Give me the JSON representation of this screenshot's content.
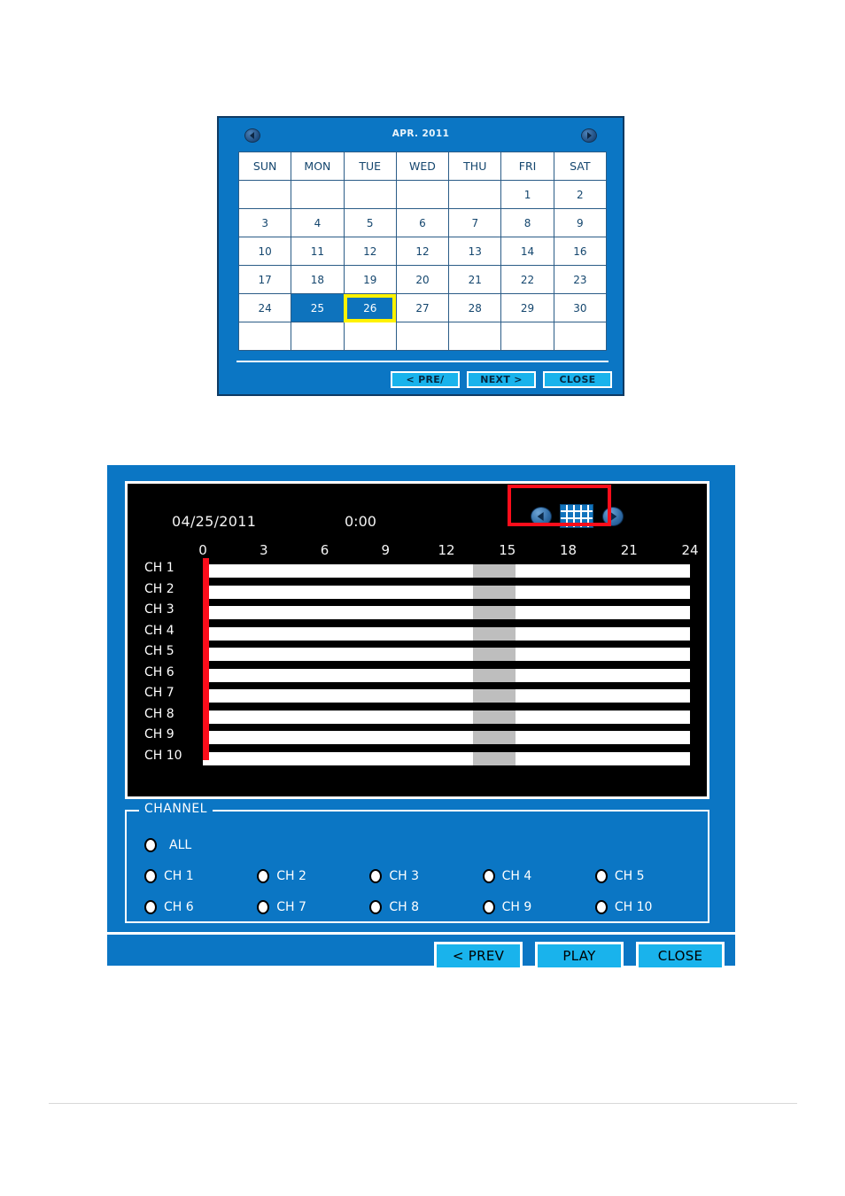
{
  "calendar_dialog": {
    "title": "APR. 2011",
    "prev_month_icon": "triangle-left-icon",
    "next_month_icon": "triangle-right-icon",
    "weekday_headers": [
      "SUN",
      "MON",
      "TUE",
      "WED",
      "THU",
      "FRI",
      "SAT"
    ],
    "weeks": [
      [
        "",
        "",
        "",
        "",
        "",
        "1",
        "2"
      ],
      [
        "3",
        "4",
        "5",
        "6",
        "7",
        "8",
        "9"
      ],
      [
        "10",
        "11",
        "12",
        "12",
        "13",
        "14",
        "16"
      ],
      [
        "17",
        "18",
        "19",
        "20",
        "21",
        "22",
        "23"
      ],
      [
        "24",
        "25",
        "26",
        "27",
        "28",
        "29",
        "30"
      ],
      [
        "",
        "",
        "",
        "",
        "",
        "",
        ""
      ]
    ],
    "selected_day": "25",
    "focused_day": "26",
    "buttons": {
      "prev": "< PRE/",
      "next": "NEXT >",
      "close": "CLOSE"
    },
    "colors": {
      "panel": "#0b76c4",
      "panel_border": "#0e3a63",
      "selected_cell": "#0e73bd",
      "focus_outline": "#fff200",
      "button": "#19b3ec",
      "cell_text": "#14466e"
    }
  },
  "search_dialog": {
    "timeline": {
      "date": "04/25/2011",
      "time": "0:00",
      "prev_day_icon": "circle-arrow-left-icon",
      "calendar_icon": "calendar-grid-icon",
      "next_day_icon": "circle-arrow-right-icon",
      "highlight_color": "#fc0d1b",
      "playhead_color": "#fc0d1b",
      "playhead_hour": 0,
      "ruler_ticks": [
        "0",
        "3",
        "6",
        "9",
        "12",
        "15",
        "18",
        "21",
        "24"
      ],
      "ruler_min_hour": 0,
      "ruler_max_hour": 24,
      "channels": [
        {
          "label": "CH 1",
          "recorded_from": 13.3,
          "recorded_to": 15.4
        },
        {
          "label": "CH 2",
          "recorded_from": 13.3,
          "recorded_to": 15.4
        },
        {
          "label": "CH 3",
          "recorded_from": 13.3,
          "recorded_to": 15.4
        },
        {
          "label": "CH 4",
          "recorded_from": 13.3,
          "recorded_to": 15.4
        },
        {
          "label": "CH 5",
          "recorded_from": 13.3,
          "recorded_to": 15.4
        },
        {
          "label": "CH 6",
          "recorded_from": 13.3,
          "recorded_to": 15.4
        },
        {
          "label": "CH 7",
          "recorded_from": 13.3,
          "recorded_to": 15.4
        },
        {
          "label": "CH 8",
          "recorded_from": 13.3,
          "recorded_to": 15.4
        },
        {
          "label": "CH 9",
          "recorded_from": 13.3,
          "recorded_to": 15.4
        },
        {
          "label": "CH 10",
          "recorded_from": 13.3,
          "recorded_to": 15.4
        }
      ]
    },
    "channel_group": {
      "legend": "CHANNEL",
      "all_option": "ALL",
      "row1": [
        "CH 1",
        "CH 2",
        "CH 3",
        "CH 4",
        "CH 5"
      ],
      "row2": [
        "CH 6",
        "CH 7",
        "CH 8",
        "CH 9",
        "CH 10"
      ]
    },
    "buttons": {
      "prev": "< PREV",
      "play": "PLAY",
      "close": "CLOSE"
    },
    "colors": {
      "panel": "#0b76c4",
      "timeline_bg": "#000000",
      "track": "#ffffff",
      "segment": "#bebebe",
      "button": "#19b3ec"
    }
  }
}
